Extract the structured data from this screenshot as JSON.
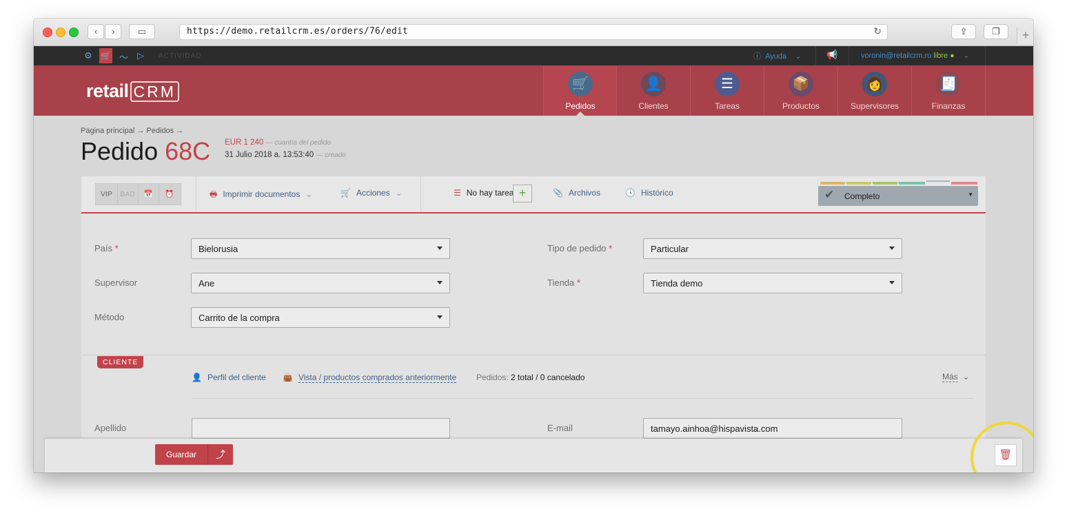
{
  "browser": {
    "url": "https://demo.retailcrm.es/orders/76/edit"
  },
  "topbar": {
    "activity": "ACTIVIDAD",
    "help": "Ayuda",
    "user_email": "voronin@retailcrm.ru",
    "user_status": "libre"
  },
  "logo": {
    "text": "retail",
    "crm": "CRM"
  },
  "nav": {
    "items": [
      {
        "label": "Pedidos",
        "icon": "shopping-cart-icon",
        "color": "#4a6a8a"
      },
      {
        "label": "Clientes",
        "icon": "person-icon",
        "color": "#6b4a5c"
      },
      {
        "label": "Tareas",
        "icon": "chat-list-icon",
        "color": "#4f5b8e"
      },
      {
        "label": "Productos",
        "icon": "box-icon",
        "color": "#6b4a6b"
      },
      {
        "label": "Supervisores",
        "icon": "woman-icon",
        "color": "#3d5878"
      },
      {
        "label": "Finanzas",
        "icon": "receipt-icon",
        "color": "#8a4a55"
      }
    ]
  },
  "page": {
    "breadcrumb": "Página principal → Pedidos →",
    "title_word": "Pedido",
    "order_number": "68C",
    "amount": "EUR 1 240",
    "amount_note": "— cuantía del pedido",
    "created_at": "31 Julio 2018 a. 13:53:40",
    "created_note": "— creado"
  },
  "actionbar": {
    "tag_vip": "VIP",
    "tag_bad": "BAD",
    "print": "Imprimir documentos",
    "actions": "Acciones",
    "no_tasks": "No hay tareas",
    "add_task": "+",
    "files": "Archivos",
    "history": "Histórico",
    "status": "Completo",
    "status_colors": [
      "#d9b86a",
      "#c9c96a",
      "#a8c46a",
      "#7cc4a8",
      "#aab4bb",
      "#e08a8f"
    ]
  },
  "form": {
    "country_label": "País",
    "country_value": "Bielorusia",
    "order_type_label": "Tipo de pedido",
    "order_type_value": "Particular",
    "supervisor_label": "Supervisor",
    "supervisor_value": "Ane",
    "store_label": "Tienda",
    "store_value": "Tienda demo",
    "method_label": "Método",
    "method_value": "Carrito de la compra",
    "required_mark": "*"
  },
  "client": {
    "badge": "CLIENTE",
    "profile_link": "Perfil del cliente",
    "purchased_link": "Vista / productos comprados anteriormente",
    "orders_label": "Pedidos:",
    "orders_value": "2 total / 0 cancelado",
    "more": "Más",
    "lastname_label": "Apellido",
    "lastname_value": "",
    "email_label": "E-mail",
    "email_value": "tamayo.ainhoa@hispavista.com"
  },
  "bottom": {
    "save": "Guardar",
    "save_exit_icon": "⤴"
  }
}
